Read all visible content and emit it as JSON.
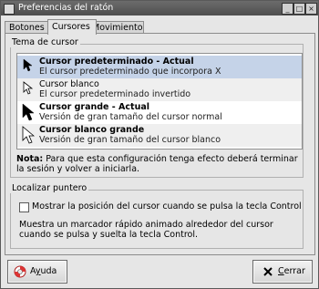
{
  "window": {
    "title": "Preferencias del ratón"
  },
  "tabs": [
    {
      "label": "Botones"
    },
    {
      "label": "Cursores"
    },
    {
      "label": "Movimiento"
    }
  ],
  "cursor_theme": {
    "section_title": "Tema de cursor",
    "items": [
      {
        "name": "Cursor predeterminado - Actual",
        "description": "El cursor predeterminado que incorpora X",
        "icon": "arrow-cursor-black-small-icon"
      },
      {
        "name": "Cursor blanco",
        "description": "El cursor predeterminado invertido",
        "icon": "arrow-cursor-white-small-icon"
      },
      {
        "name": "Cursor grande - Actual",
        "description": "Versión de gran tamaño del cursor normal",
        "icon": "arrow-cursor-black-large-icon"
      },
      {
        "name": "Cursor blanco grande",
        "description": "Versión de gran tamaño del cursor blanco",
        "icon": "arrow-cursor-white-large-icon"
      }
    ],
    "selected_index": 0,
    "note_bold": "Nota:",
    "note_text": " Para que esta configuración tenga efecto deberá terminar la sesión y volver a iniciarla."
  },
  "locate_pointer": {
    "section_title": "Localizar puntero",
    "checkbox_label": "Mostrar la posición del cursor cuando se pulsa la tecla Control",
    "checked": false,
    "description": "Muestra un marcador rápido animado alrededor del cursor cuando se pulsa y suelta la tecla Control."
  },
  "buttons": {
    "help_prefix": "A",
    "help_mnemonic": "y",
    "help_suffix": "uda",
    "close_mnemonic": "C",
    "close_suffix": "errar"
  },
  "colors": {
    "selection": "#c5d3e8",
    "titlebar": "#5a5a5a"
  }
}
